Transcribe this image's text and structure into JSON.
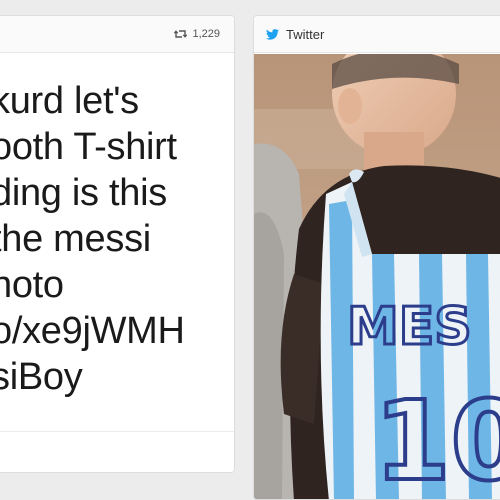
{
  "left_card": {
    "retweet_icon": "retweet-icon",
    "retweet_count": "1,229",
    "tweet_lines": [
      "kurd let's",
      "ooth T-shirt",
      "ding is this",
      "the messi",
      "hoto",
      "o/xe9jWMH",
      "siBoy"
    ]
  },
  "right_card": {
    "source_icon": "twitter-bird-icon",
    "source_label": "Twitter",
    "photo": {
      "subject": "photo-of-child-in-striped-plastic-bag-jersey",
      "jersey_text": "MES",
      "jersey_number": "10"
    }
  },
  "colors": {
    "twitter_blue": "#1da1f2",
    "stripe_blue": "#6eb6e6",
    "jersey_ink": "#2c3d8c"
  }
}
